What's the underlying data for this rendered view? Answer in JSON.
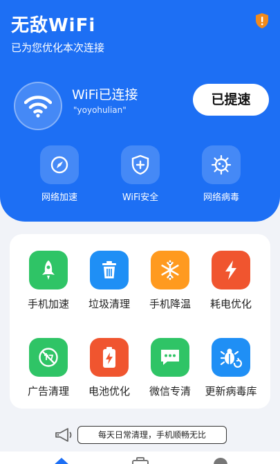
{
  "header": {
    "app_title": "无敌WiFi",
    "subtitle": "已为您优化本次连接",
    "badge_icon": "shield-alert-icon"
  },
  "connection": {
    "status": "WiFi已连接",
    "ssid": "\"yoyohulian\"",
    "boost_label": "已提速"
  },
  "hero_tools": [
    {
      "label": "网络加速",
      "icon": "speed-compass-icon"
    },
    {
      "label": "WiFi安全",
      "icon": "shield-plus-icon"
    },
    {
      "label": "网络病毒",
      "icon": "virus-icon"
    }
  ],
  "features": [
    {
      "label": "手机加速",
      "icon": "rocket-icon",
      "color": "#2fc466"
    },
    {
      "label": "垃圾清理",
      "icon": "trash-icon",
      "color": "#1f8ff5"
    },
    {
      "label": "手机降温",
      "icon": "snowflake-icon",
      "color": "#ff9a1f"
    },
    {
      "label": "耗电优化",
      "icon": "lightning-icon",
      "color": "#f0552f"
    },
    {
      "label": "广告清理",
      "icon": "no-ads-icon",
      "color": "#2fc466"
    },
    {
      "label": "电池优化",
      "icon": "battery-icon",
      "color": "#f0552f"
    },
    {
      "label": "微信专清",
      "icon": "chat-icon",
      "color": "#2fc466"
    },
    {
      "label": "更新病毒库",
      "icon": "bug-update-icon",
      "color": "#1f8ff5"
    }
  ],
  "tip": {
    "text": "每天日常清理，手机顺畅无比",
    "icon": "megaphone-icon"
  },
  "tabbar": {
    "items": [
      {
        "icon": "home-icon",
        "color": "#1d6ff4"
      },
      {
        "icon": "toolbox-icon",
        "color": "#777777"
      },
      {
        "icon": "profile-icon",
        "color": "#777777"
      }
    ]
  },
  "colors": {
    "brand": "#1d6ff4",
    "alert": "#f08a1c"
  }
}
